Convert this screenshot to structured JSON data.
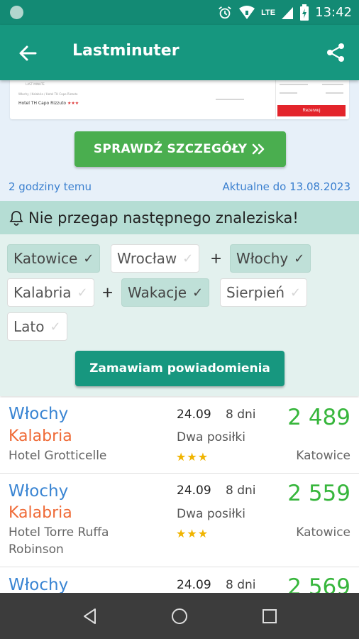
{
  "status_bar": {
    "time": "13:42",
    "network": "LTE"
  },
  "app_bar": {
    "title": "Lastminuter"
  },
  "preview": {
    "thumb_brand": "LAST MINUTE",
    "thumb_breadcrumb": "Włochy / Kalabria / Hotel TH Capo Rizzuto",
    "thumb_title": "Hotel TH Capo Rizzuto",
    "thumb_stars": "★★★",
    "thumb_book": "Rezerwuj",
    "details_button": "SPRAWDŹ SZCZEGÓŁY",
    "posted": "2 godziny temu",
    "valid": "Aktualne do 13.08.2023"
  },
  "notify": {
    "heading": "Nie przegap następnego znaleziska!",
    "chips": [
      {
        "label": "Katowice",
        "on": true
      },
      {
        "label": "Wrocław",
        "on": false
      },
      {
        "label": "Włochy",
        "on": true
      },
      {
        "label": "Kalabria",
        "on": false
      },
      {
        "label": "Wakacje",
        "on": true
      },
      {
        "label": "Sierpień",
        "on": false
      },
      {
        "label": "Lato",
        "on": false
      }
    ],
    "plus": "+",
    "check": "✓",
    "order_button": "Zamawiam powiadomienia"
  },
  "offers": [
    {
      "country": "Włochy",
      "region": "Kalabria",
      "hotel": "Hotel Grotticelle",
      "date": "24.09",
      "nights": "8 dni",
      "board": "Dwa posiłki",
      "stars": "★★★",
      "price": "2 489",
      "city": "Katowice"
    },
    {
      "country": "Włochy",
      "region": "Kalabria",
      "hotel": "Hotel Torre Ruffa Robinson",
      "date": "24.09",
      "nights": "8 dni",
      "board": "Dwa posiłki",
      "stars": "★★★",
      "price": "2 559",
      "city": "Katowice"
    },
    {
      "country": "Włochy",
      "region": "",
      "hotel": "",
      "date": "24.09",
      "nights": "8 dni",
      "board": "",
      "stars": "",
      "price": "2 569",
      "city": ""
    }
  ],
  "colors": {
    "primary": "#16977f",
    "accent_green": "#4aae4f",
    "price": "#37b63c",
    "country": "#3a85d3",
    "region": "#ef6a36"
  }
}
